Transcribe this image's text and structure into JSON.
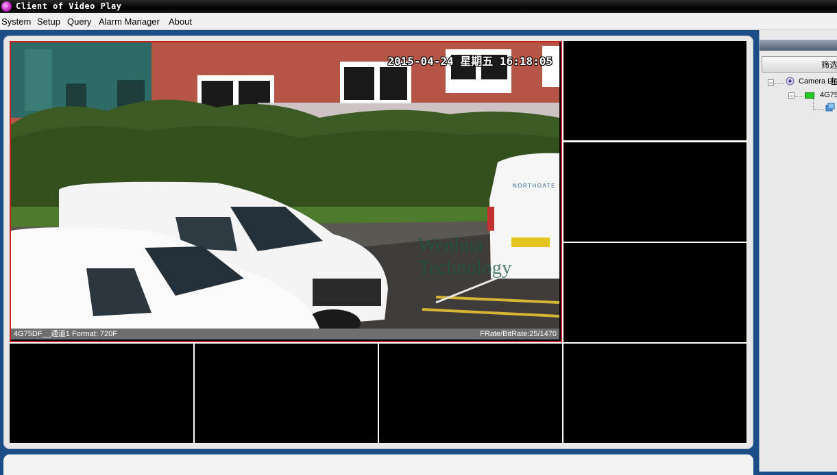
{
  "window": {
    "title": "Client of Video Play"
  },
  "menu": [
    {
      "label": "System"
    },
    {
      "label": "Setup"
    },
    {
      "label": "Query"
    },
    {
      "label": "Alarm Manager"
    },
    {
      "label": "About"
    }
  ],
  "video": {
    "main_feed": {
      "osd_timestamp": "2015-04-24 星期五 16:18:05",
      "watermark": "Wenhua Technology",
      "channel_info": "4G75DF__通道1 Format: 720F",
      "rate_info": "FRate/BitRate:25/1470"
    }
  },
  "sidebar": {
    "filter_button_label": "筛选在",
    "tree": {
      "root_label": "Camera List",
      "device_label": "4G75",
      "expander_symbol": "−"
    }
  },
  "colors": {
    "frame_blue": "#1b4e86",
    "selection_red": "#c81e1e",
    "device_green": "#22cc22"
  }
}
